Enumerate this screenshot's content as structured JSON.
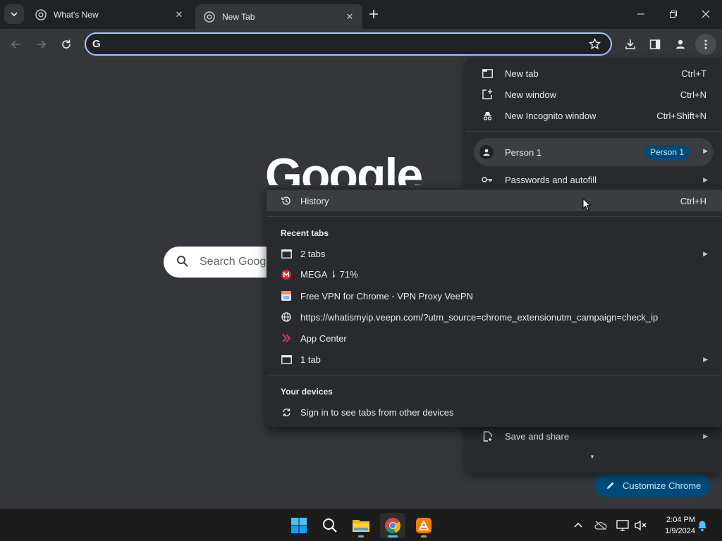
{
  "tabs": [
    {
      "title": "What's New",
      "active": false
    },
    {
      "title": "New Tab",
      "active": true
    }
  ],
  "omnibox": {
    "value": "",
    "engine_icon": "G"
  },
  "new_tab_page": {
    "logo": "Google",
    "search_placeholder": "Search Google",
    "customize_label": "Customize Chrome"
  },
  "main_menu": {
    "new_tab": {
      "label": "New tab",
      "shortcut": "Ctrl+T"
    },
    "new_window": {
      "label": "New window",
      "shortcut": "Ctrl+N"
    },
    "new_incognito": {
      "label": "New Incognito window",
      "shortcut": "Ctrl+Shift+N"
    },
    "person": {
      "label": "Person 1",
      "badge": "Person 1"
    },
    "passwords": {
      "label": "Passwords and autofill"
    },
    "save_share": {
      "label": "Save and share"
    }
  },
  "history_menu": {
    "history": {
      "label": "History",
      "shortcut": "Ctrl+H"
    },
    "recent_tabs_heading": "Recent tabs",
    "recent_tabs": [
      {
        "label": "2 tabs",
        "icon": "window-icon",
        "has_submenu": true
      },
      {
        "label": "MEGA ⇂ 71%",
        "icon": "mega-icon",
        "has_submenu": false
      },
      {
        "label": "Free VPN for Chrome - VPN Proxy VeePN",
        "icon": "veepn-icon",
        "has_submenu": false
      },
      {
        "label": "https://whatismyip.veepn.com/?utm_source=chrome_extensionutm_campaign=check_ip",
        "icon": "globe-icon",
        "has_submenu": false
      },
      {
        "label": "App Center",
        "icon": "app-center-icon",
        "has_submenu": false
      },
      {
        "label": "1 tab",
        "icon": "window-icon",
        "has_submenu": true
      }
    ],
    "devices_heading": "Your devices",
    "sign_in": {
      "label": "Sign in to see tabs from other devices"
    }
  },
  "taskbar": {
    "time": "2:04 PM",
    "date": "1/9/2024"
  },
  "colors": {
    "frame": "#202124",
    "toolbar": "#35363a",
    "menu": "#292a2d",
    "accent": "#a8c7fa",
    "badge": "#004a77"
  }
}
